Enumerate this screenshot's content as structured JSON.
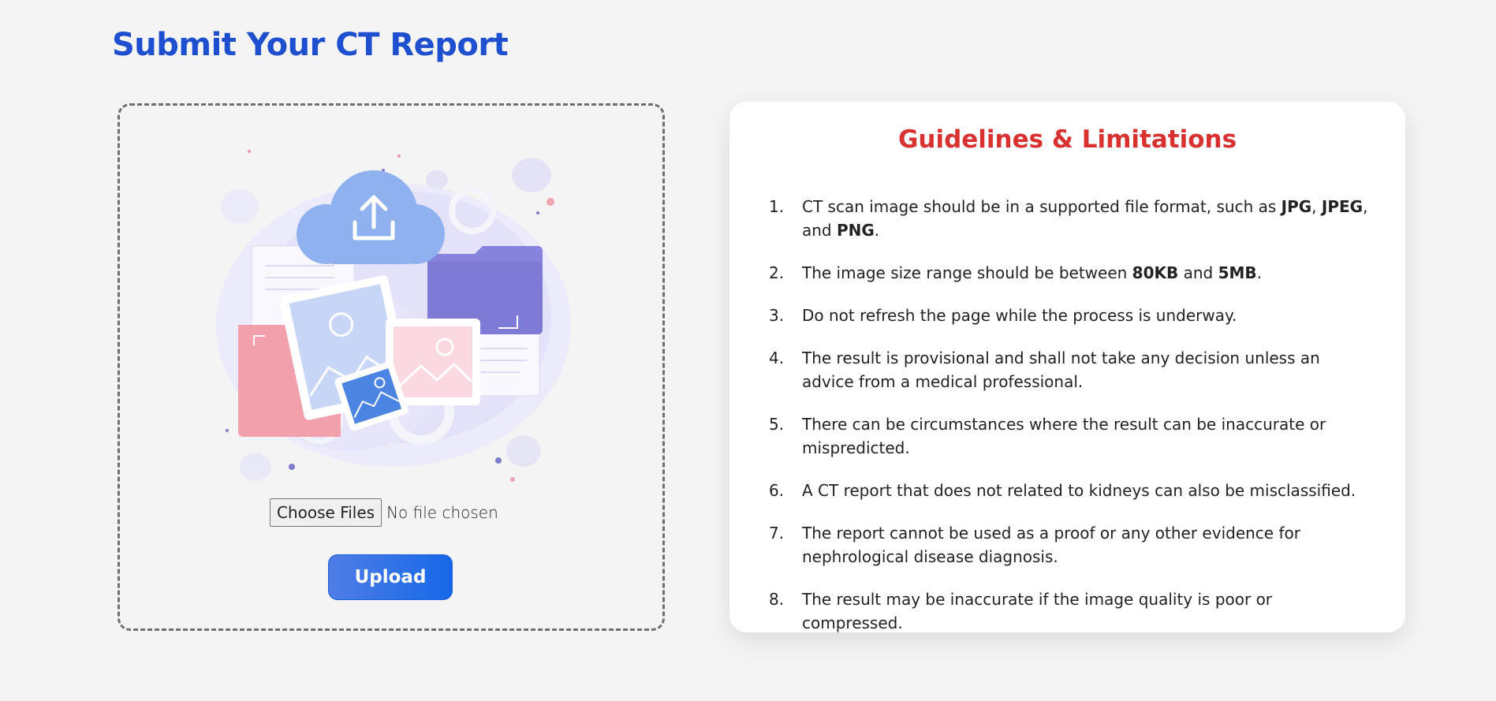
{
  "page": {
    "title": "Submit Your CT Report"
  },
  "upload": {
    "illustration_icon": "cloud-upload-files-illustration",
    "choose_files_label": "Choose Files",
    "no_file_text": "No file chosen",
    "upload_label": "Upload"
  },
  "guidelines": {
    "title": "Guidelines & Limitations",
    "items": [
      {
        "number": "1.",
        "parts": [
          {
            "text": "CT scan image should be in a supported file format, such as ",
            "bold": false
          },
          {
            "text": "JPG",
            "bold": true
          },
          {
            "text": ", ",
            "bold": false
          },
          {
            "text": "JPEG",
            "bold": true
          },
          {
            "text": ", and ",
            "bold": false
          },
          {
            "text": "PNG",
            "bold": true
          },
          {
            "text": ".",
            "bold": false
          }
        ]
      },
      {
        "number": "2.",
        "parts": [
          {
            "text": "The image size range should be between ",
            "bold": false
          },
          {
            "text": "80KB",
            "bold": true
          },
          {
            "text": " and ",
            "bold": false
          },
          {
            "text": "5MB",
            "bold": true
          },
          {
            "text": ".",
            "bold": false
          }
        ]
      },
      {
        "number": "3.",
        "parts": [
          {
            "text": "Do not refresh the page while the process is underway.",
            "bold": false
          }
        ]
      },
      {
        "number": "4.",
        "parts": [
          {
            "text": "The result is provisional and shall not take any decision unless an advice from a medical professional.",
            "bold": false
          }
        ]
      },
      {
        "number": "5.",
        "parts": [
          {
            "text": "There can be circumstances where the result can be inaccurate or mispredicted.",
            "bold": false
          }
        ]
      },
      {
        "number": "6.",
        "parts": [
          {
            "text": "A CT report that does not related to kidneys can also be misclassified.",
            "bold": false
          }
        ]
      },
      {
        "number": "7.",
        "parts": [
          {
            "text": "The report cannot be used as a proof or any other evidence for nephrological disease diagnosis.",
            "bold": false
          }
        ]
      },
      {
        "number": "8.",
        "parts": [
          {
            "text": "The result may be inaccurate if the image quality is poor or compressed.",
            "bold": false
          }
        ]
      }
    ]
  },
  "colors": {
    "page_title": "#1e4fcf",
    "guidelines_title": "#d8312f",
    "upload_button_start": "#4f7de6",
    "upload_button_end": "#1668e8",
    "background": "#f4f4f4"
  }
}
